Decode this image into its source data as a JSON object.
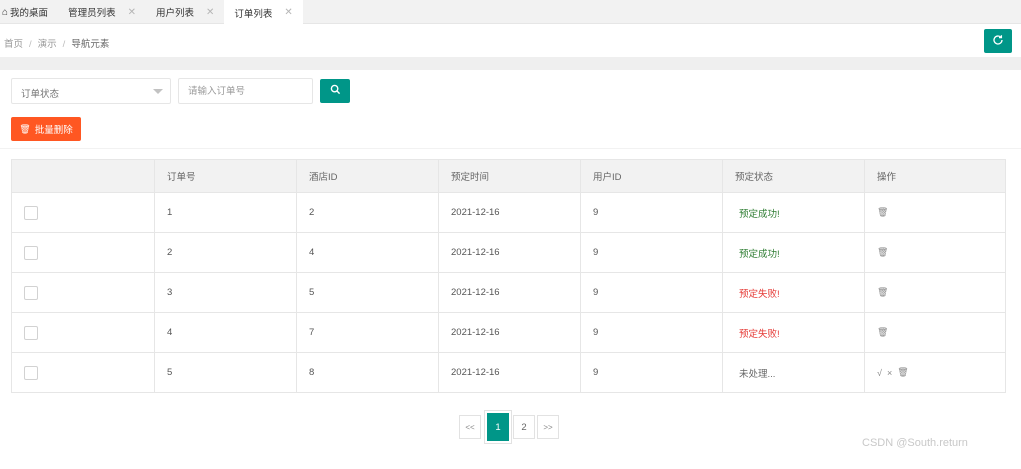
{
  "tabs": [
    {
      "label": "我的桌面",
      "closable": false,
      "active": false,
      "icon": "home-icon"
    },
    {
      "label": "管理员列表",
      "closable": true,
      "active": false
    },
    {
      "label": "用户列表",
      "closable": true,
      "active": false
    },
    {
      "label": "订单列表",
      "closable": true,
      "active": true
    }
  ],
  "tab_close_glyph": "✕",
  "breadcrumb": {
    "items": [
      "首页",
      "演示",
      "导航元素"
    ],
    "separator": "/"
  },
  "refresh_icon": "refresh-icon",
  "search": {
    "status_select": {
      "value": "订单状态"
    },
    "order_input": {
      "placeholder": "请输入订单号",
      "value": ""
    },
    "search_icon": "search-icon"
  },
  "toolbar": {
    "batch_delete_label": "批量删除",
    "batch_delete_icon": "trash-icon"
  },
  "table": {
    "headers": [
      "",
      "订单号",
      "酒店ID",
      "预定时间",
      "用户ID",
      "预定状态",
      "操作"
    ],
    "rows": [
      {
        "order_no": "1",
        "hotel_id": "2",
        "time": "2021-12-16",
        "user_id": "9",
        "status": "预定成功!",
        "status_color": "#2e7d32",
        "ops": [
          "delete"
        ]
      },
      {
        "order_no": "2",
        "hotel_id": "4",
        "time": "2021-12-16",
        "user_id": "9",
        "status": "预定成功!",
        "status_color": "#2e7d32",
        "ops": [
          "delete"
        ]
      },
      {
        "order_no": "3",
        "hotel_id": "5",
        "time": "2021-12-16",
        "user_id": "9",
        "status": "预定失败!",
        "status_color": "#e53935",
        "ops": [
          "delete"
        ]
      },
      {
        "order_no": "4",
        "hotel_id": "7",
        "time": "2021-12-16",
        "user_id": "9",
        "status": "预定失败!",
        "status_color": "#e53935",
        "ops": [
          "delete"
        ]
      },
      {
        "order_no": "5",
        "hotel_id": "8",
        "time": "2021-12-16",
        "user_id": "9",
        "status": "未处理...",
        "status_color": "#666666",
        "ops": [
          "approve",
          "reject",
          "delete"
        ]
      }
    ],
    "op_glyphs": {
      "approve": "√",
      "reject": "×",
      "delete": "🗑"
    }
  },
  "pagination": {
    "prev": "<<",
    "next": ">>",
    "pages": [
      "1",
      "2"
    ],
    "current": "1"
  },
  "watermark": "CSDN @South.return",
  "colors": {
    "primary": "#009688",
    "danger": "#ff5722",
    "success": "#2e7d32",
    "fail": "#e53935"
  }
}
